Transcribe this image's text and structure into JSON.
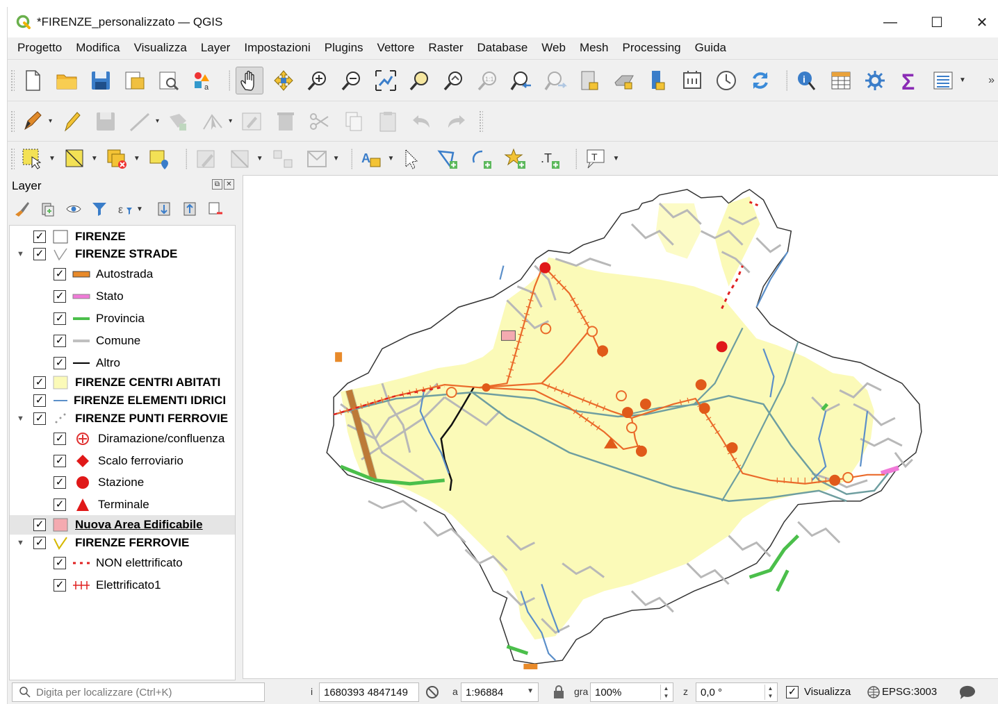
{
  "window": {
    "title": "*FIRENZE_personalizzato — QGIS",
    "controls": {
      "minimize": "—",
      "maximize": "☐",
      "close": "✕"
    }
  },
  "menu": [
    "Progetto",
    "Modifica",
    "Visualizza",
    "Layer",
    "Impostazioni",
    "Plugins",
    "Vettore",
    "Raster",
    "Database",
    "Web",
    "Mesh",
    "Processing",
    "Guida"
  ],
  "layer_panel": {
    "title": "Layer",
    "tree": [
      {
        "label": "FIRENZE",
        "bold": true,
        "level": 0,
        "checked": true
      },
      {
        "label": "FIRENZE STRADE",
        "bold": true,
        "level": 0,
        "checked": true,
        "expanded": true
      },
      {
        "label": "Autostrada",
        "level": 1,
        "checked": true,
        "color": "#e88a2a"
      },
      {
        "label": "Stato",
        "level": 1,
        "checked": true,
        "color": "#f07ad8"
      },
      {
        "label": "Provincia",
        "level": 1,
        "checked": true,
        "color": "#4bbf4b"
      },
      {
        "label": "Comune",
        "level": 1,
        "checked": true,
        "color": "#c0c0c0"
      },
      {
        "label": "Altro",
        "level": 1,
        "checked": true,
        "color": "#000000"
      },
      {
        "label": "FIRENZE CENTRI ABITATI",
        "bold": true,
        "level": 0,
        "checked": true,
        "color": "#fbfab8"
      },
      {
        "label": "FIRENZE ELEMENTI IDRICI",
        "bold": true,
        "level": 0,
        "checked": true,
        "color": "#5b8fc9"
      },
      {
        "label": "FIRENZE PUNTI FERROVIE",
        "bold": true,
        "level": 0,
        "checked": true,
        "expanded": true
      },
      {
        "label": "Diramazione/confluenza",
        "level": 1,
        "checked": true,
        "color": "#e03030"
      },
      {
        "label": "Scalo ferroviario",
        "level": 1,
        "checked": true,
        "color": "#e01818"
      },
      {
        "label": "Stazione",
        "level": 1,
        "checked": true,
        "color": "#e01818"
      },
      {
        "label": "Terminale",
        "level": 1,
        "checked": true,
        "color": "#e01818"
      },
      {
        "label": "Nuova Area Edificabile",
        "bold": true,
        "underline": true,
        "level": 0,
        "checked": true,
        "selected": true,
        "color": "#f4aab0"
      },
      {
        "label": "FIRENZE FERROVIE",
        "bold": true,
        "level": 0,
        "checked": true,
        "expanded": true
      },
      {
        "label": "NON elettrificato",
        "level": 1,
        "checked": true,
        "color": "#e02020"
      },
      {
        "label": "Elettrificato1",
        "level": 1,
        "checked": true,
        "color": "#e02020"
      }
    ]
  },
  "statusbar": {
    "locator_placeholder": "Digita per localizzare (Ctrl+K)",
    "coordinate_label": "i",
    "coordinate": "1680393 4847149",
    "scale_label": "a",
    "scale": "1:96884",
    "magnifier_label": "gra",
    "magnifier": "100%",
    "rotation_label": "z",
    "rotation": "0,0 °",
    "render_label": "Visualizza",
    "render_checked": true,
    "crs": "EPSG:3003"
  },
  "colors": {
    "municipality_fill": "#ffffff",
    "urban_fill": "#fbfab8",
    "water": "#5b8fc9",
    "river": "#6e9ea0",
    "railway": "#ea6a2a",
    "station": "#e05a1a",
    "roads": "#b8b8b8"
  },
  "icons": {
    "toolbar1": [
      "new-project-icon",
      "open-project-icon",
      "save-project-icon",
      "print-layout-icon",
      "layout-manager-icon",
      "style-manager-icon",
      "pan-icon",
      "pan-to-selection-icon",
      "zoom-in-icon",
      "zoom-out-icon",
      "zoom-full-icon",
      "zoom-to-selection-icon",
      "zoom-to-layer-icon",
      "zoom-native-icon",
      "zoom-last-icon",
      "zoom-next-icon",
      "new-bookmark-icon",
      "show-bookmarks-icon",
      "new-3d-view-icon",
      "temporal-icon",
      "refresh-icon",
      "identify-icon",
      "attribute-table-icon",
      "settings-icon",
      "statistics-icon",
      "toolbox-icon"
    ],
    "toolbar2": [
      "edit-pencil-icon",
      "toggle-editing-icon",
      "save-edits-icon",
      "digitize-line-icon",
      "add-feature-icon",
      "vertex-tool-icon",
      "modify-attributes-icon",
      "delete-icon",
      "cut-icon",
      "copy-icon",
      "paste-icon",
      "undo-icon",
      "redo-icon"
    ],
    "toolbar3": [
      "select-features-icon",
      "select-polygon-icon",
      "deselect-icon",
      "select-by-value-icon",
      "edit-pencil-icon",
      "split-icon",
      "merge-icon",
      "reshape-icon",
      "label-icon",
      "select-label-icon",
      "add-vertex-icon",
      "add-ring-icon",
      "add-star-icon",
      "text-annotation-icon",
      "text-tool-icon"
    ]
  }
}
